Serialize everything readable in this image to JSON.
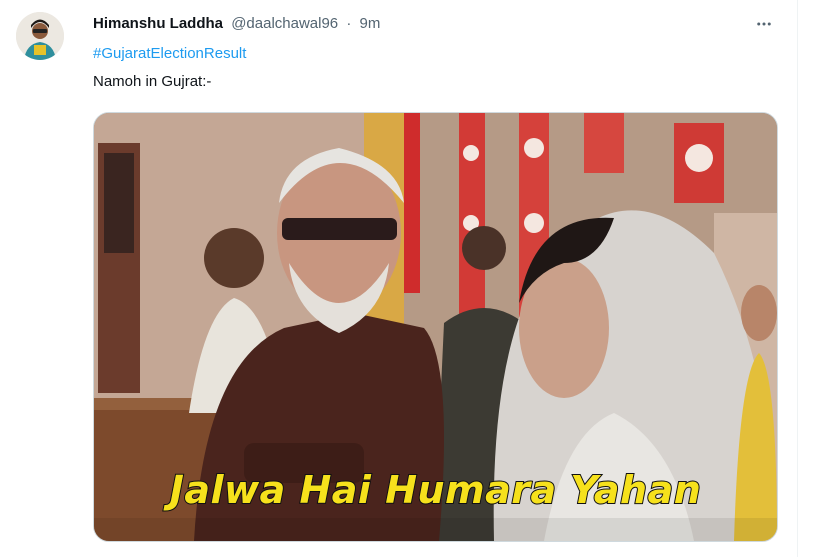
{
  "tweet": {
    "display_name": "Himanshu Laddha",
    "handle": "@daalchawal96",
    "separator": "·",
    "time": "9m",
    "hashtag": "#GujaratElectionResult",
    "text": "Namoh in Gujrat:-",
    "media_caption": "Jalwa Hai Humara Yahan",
    "more_icon": "more-horizontal-icon"
  },
  "colors": {
    "link": "#1d9bf0",
    "text_primary": "#0f1419",
    "text_secondary": "#536471",
    "caption_fill": "#f6e11c"
  }
}
